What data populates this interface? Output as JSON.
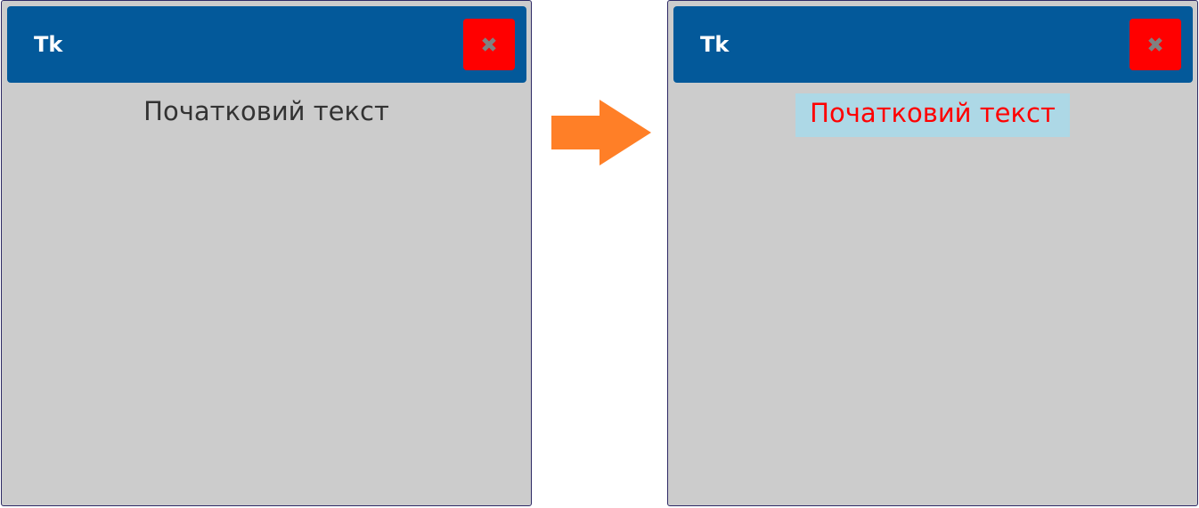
{
  "windows": {
    "before": {
      "title": "Tk",
      "close_icon": "close-x-icon",
      "text": "Початковий текст",
      "text_color": "#333333"
    },
    "after": {
      "title": "Tk",
      "close_icon": "close-x-icon",
      "text": "Початковий текст",
      "text_color": "#ff0000",
      "text_background": "#add8e6"
    }
  },
  "arrow": {
    "icon": "right-arrow-icon",
    "color": "#ff7f27"
  },
  "colors": {
    "titlebar": "#03599a",
    "window_bg": "#cccccc",
    "close_button": "#ff0000",
    "close_glyph": "#808080"
  }
}
